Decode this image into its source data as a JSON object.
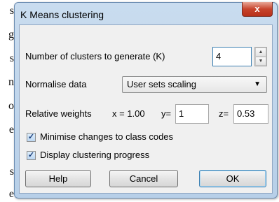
{
  "background_text": [
    "s",
    "g",
    "s",
    "n",
    "o",
    "e",
    "s",
    "e"
  ],
  "dialog": {
    "title": "K Means clustering",
    "close_label": "x"
  },
  "clusters": {
    "label": "Number of clusters to generate (K)",
    "value": "4"
  },
  "normalise": {
    "label": "Normalise data",
    "selected": "User sets scaling"
  },
  "weights": {
    "label": "Relative weights",
    "x_label": "x = 1.00",
    "y_label": "y=",
    "y_value": "1",
    "z_label": "z=",
    "z_value": "0.53"
  },
  "options": {
    "minimise_label": "Minimise changes to class codes",
    "minimise_checked": true,
    "display_label": "Display clustering progress",
    "display_checked": true
  },
  "buttons": {
    "help": "Help",
    "cancel": "Cancel",
    "ok": "OK"
  }
}
